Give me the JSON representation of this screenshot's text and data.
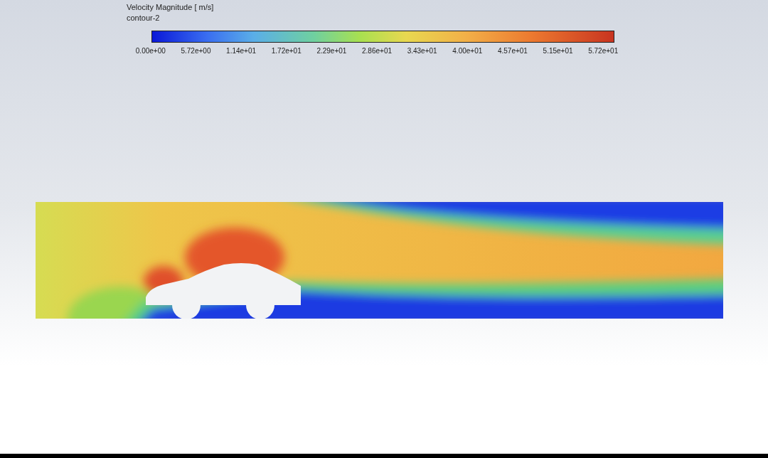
{
  "legend": {
    "title": "Velocity Magnitude [ m/s]",
    "subtitle": "contour-2",
    "tick_labels": [
      "0.00e+00",
      "5.72e+00",
      "1.14e+01",
      "1.72e+01",
      "2.29e+01",
      "2.86e+01",
      "3.43e+01",
      "4.00e+01",
      "4.57e+01",
      "5.15e+01",
      "5.72e+01"
    ]
  }
}
